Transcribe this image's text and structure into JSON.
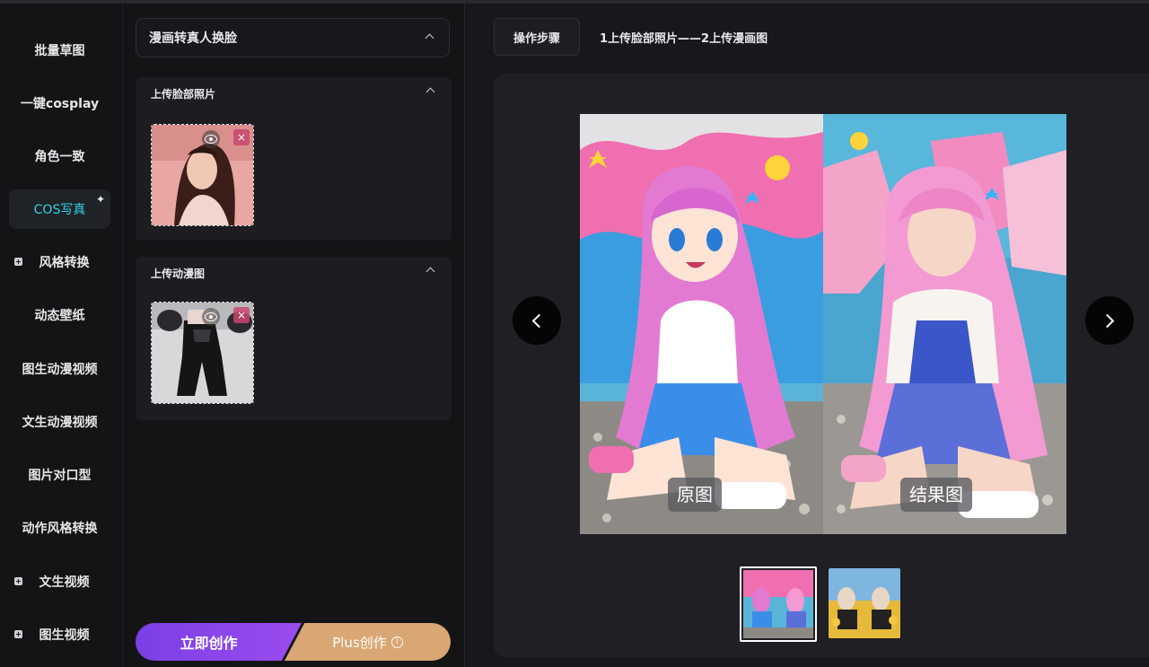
{
  "nav": {
    "items": [
      {
        "label": "批量草图",
        "plus": false,
        "active": false
      },
      {
        "label": "一键cosplay",
        "plus": false,
        "active": false
      },
      {
        "label": "角色一致",
        "plus": false,
        "active": false
      },
      {
        "label": "COS写真",
        "plus": false,
        "active": true
      },
      {
        "label": "风格转换",
        "plus": true,
        "active": false
      },
      {
        "label": "动态壁纸",
        "plus": false,
        "active": false
      },
      {
        "label": "图生动漫视频",
        "plus": false,
        "active": false
      },
      {
        "label": "文生动漫视频",
        "plus": false,
        "active": false
      },
      {
        "label": "图片对口型",
        "plus": false,
        "active": false
      },
      {
        "label": "动作风格转换",
        "plus": false,
        "active": false
      },
      {
        "label": "文生视频",
        "plus": true,
        "active": false
      },
      {
        "label": "图生视频",
        "plus": true,
        "active": false
      }
    ]
  },
  "mode": {
    "selected": "漫画转真人换脸"
  },
  "upload_face": {
    "title": "上传脸部照片"
  },
  "upload_anime": {
    "title": "上传动漫图"
  },
  "actions": {
    "create": "立即创作",
    "plus": "Plus创作",
    "info_icon": "ⓘ"
  },
  "steps": {
    "button": "操作步骤",
    "text": "1上传脸部照片——2上传漫画图"
  },
  "viewer": {
    "label_original": "原图",
    "label_result": "结果图"
  },
  "icons": {
    "eye": "eye-icon",
    "close": "close-icon",
    "chevron": "chevron-up-icon",
    "sparkle": "✦"
  },
  "colors": {
    "accent": "#2fd3e6",
    "create": "#8a45ea",
    "plus": "#d9a773"
  }
}
